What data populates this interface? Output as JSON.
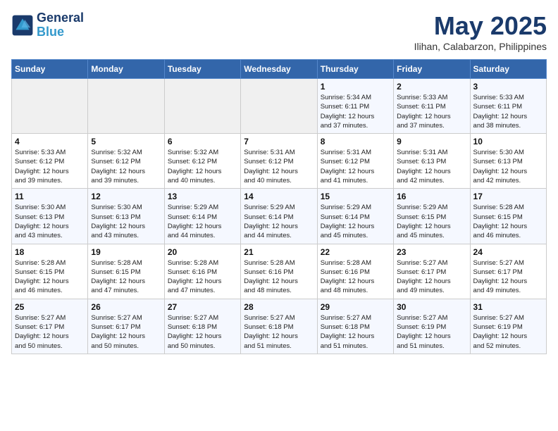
{
  "header": {
    "logo_line1": "General",
    "logo_line2": "Blue",
    "title": "May 2025",
    "subtitle": "Ilihan, Calabarzon, Philippines"
  },
  "weekdays": [
    "Sunday",
    "Monday",
    "Tuesday",
    "Wednesday",
    "Thursday",
    "Friday",
    "Saturday"
  ],
  "weeks": [
    [
      {
        "day": "",
        "info": ""
      },
      {
        "day": "",
        "info": ""
      },
      {
        "day": "",
        "info": ""
      },
      {
        "day": "",
        "info": ""
      },
      {
        "day": "1",
        "info": "Sunrise: 5:34 AM\nSunset: 6:11 PM\nDaylight: 12 hours\nand 37 minutes."
      },
      {
        "day": "2",
        "info": "Sunrise: 5:33 AM\nSunset: 6:11 PM\nDaylight: 12 hours\nand 37 minutes."
      },
      {
        "day": "3",
        "info": "Sunrise: 5:33 AM\nSunset: 6:11 PM\nDaylight: 12 hours\nand 38 minutes."
      }
    ],
    [
      {
        "day": "4",
        "info": "Sunrise: 5:33 AM\nSunset: 6:12 PM\nDaylight: 12 hours\nand 39 minutes."
      },
      {
        "day": "5",
        "info": "Sunrise: 5:32 AM\nSunset: 6:12 PM\nDaylight: 12 hours\nand 39 minutes."
      },
      {
        "day": "6",
        "info": "Sunrise: 5:32 AM\nSunset: 6:12 PM\nDaylight: 12 hours\nand 40 minutes."
      },
      {
        "day": "7",
        "info": "Sunrise: 5:31 AM\nSunset: 6:12 PM\nDaylight: 12 hours\nand 40 minutes."
      },
      {
        "day": "8",
        "info": "Sunrise: 5:31 AM\nSunset: 6:12 PM\nDaylight: 12 hours\nand 41 minutes."
      },
      {
        "day": "9",
        "info": "Sunrise: 5:31 AM\nSunset: 6:13 PM\nDaylight: 12 hours\nand 42 minutes."
      },
      {
        "day": "10",
        "info": "Sunrise: 5:30 AM\nSunset: 6:13 PM\nDaylight: 12 hours\nand 42 minutes."
      }
    ],
    [
      {
        "day": "11",
        "info": "Sunrise: 5:30 AM\nSunset: 6:13 PM\nDaylight: 12 hours\nand 43 minutes."
      },
      {
        "day": "12",
        "info": "Sunrise: 5:30 AM\nSunset: 6:13 PM\nDaylight: 12 hours\nand 43 minutes."
      },
      {
        "day": "13",
        "info": "Sunrise: 5:29 AM\nSunset: 6:14 PM\nDaylight: 12 hours\nand 44 minutes."
      },
      {
        "day": "14",
        "info": "Sunrise: 5:29 AM\nSunset: 6:14 PM\nDaylight: 12 hours\nand 44 minutes."
      },
      {
        "day": "15",
        "info": "Sunrise: 5:29 AM\nSunset: 6:14 PM\nDaylight: 12 hours\nand 45 minutes."
      },
      {
        "day": "16",
        "info": "Sunrise: 5:29 AM\nSunset: 6:15 PM\nDaylight: 12 hours\nand 45 minutes."
      },
      {
        "day": "17",
        "info": "Sunrise: 5:28 AM\nSunset: 6:15 PM\nDaylight: 12 hours\nand 46 minutes."
      }
    ],
    [
      {
        "day": "18",
        "info": "Sunrise: 5:28 AM\nSunset: 6:15 PM\nDaylight: 12 hours\nand 46 minutes."
      },
      {
        "day": "19",
        "info": "Sunrise: 5:28 AM\nSunset: 6:15 PM\nDaylight: 12 hours\nand 47 minutes."
      },
      {
        "day": "20",
        "info": "Sunrise: 5:28 AM\nSunset: 6:16 PM\nDaylight: 12 hours\nand 47 minutes."
      },
      {
        "day": "21",
        "info": "Sunrise: 5:28 AM\nSunset: 6:16 PM\nDaylight: 12 hours\nand 48 minutes."
      },
      {
        "day": "22",
        "info": "Sunrise: 5:28 AM\nSunset: 6:16 PM\nDaylight: 12 hours\nand 48 minutes."
      },
      {
        "day": "23",
        "info": "Sunrise: 5:27 AM\nSunset: 6:17 PM\nDaylight: 12 hours\nand 49 minutes."
      },
      {
        "day": "24",
        "info": "Sunrise: 5:27 AM\nSunset: 6:17 PM\nDaylight: 12 hours\nand 49 minutes."
      }
    ],
    [
      {
        "day": "25",
        "info": "Sunrise: 5:27 AM\nSunset: 6:17 PM\nDaylight: 12 hours\nand 50 minutes."
      },
      {
        "day": "26",
        "info": "Sunrise: 5:27 AM\nSunset: 6:17 PM\nDaylight: 12 hours\nand 50 minutes."
      },
      {
        "day": "27",
        "info": "Sunrise: 5:27 AM\nSunset: 6:18 PM\nDaylight: 12 hours\nand 50 minutes."
      },
      {
        "day": "28",
        "info": "Sunrise: 5:27 AM\nSunset: 6:18 PM\nDaylight: 12 hours\nand 51 minutes."
      },
      {
        "day": "29",
        "info": "Sunrise: 5:27 AM\nSunset: 6:18 PM\nDaylight: 12 hours\nand 51 minutes."
      },
      {
        "day": "30",
        "info": "Sunrise: 5:27 AM\nSunset: 6:19 PM\nDaylight: 12 hours\nand 51 minutes."
      },
      {
        "day": "31",
        "info": "Sunrise: 5:27 AM\nSunset: 6:19 PM\nDaylight: 12 hours\nand 52 minutes."
      }
    ]
  ]
}
